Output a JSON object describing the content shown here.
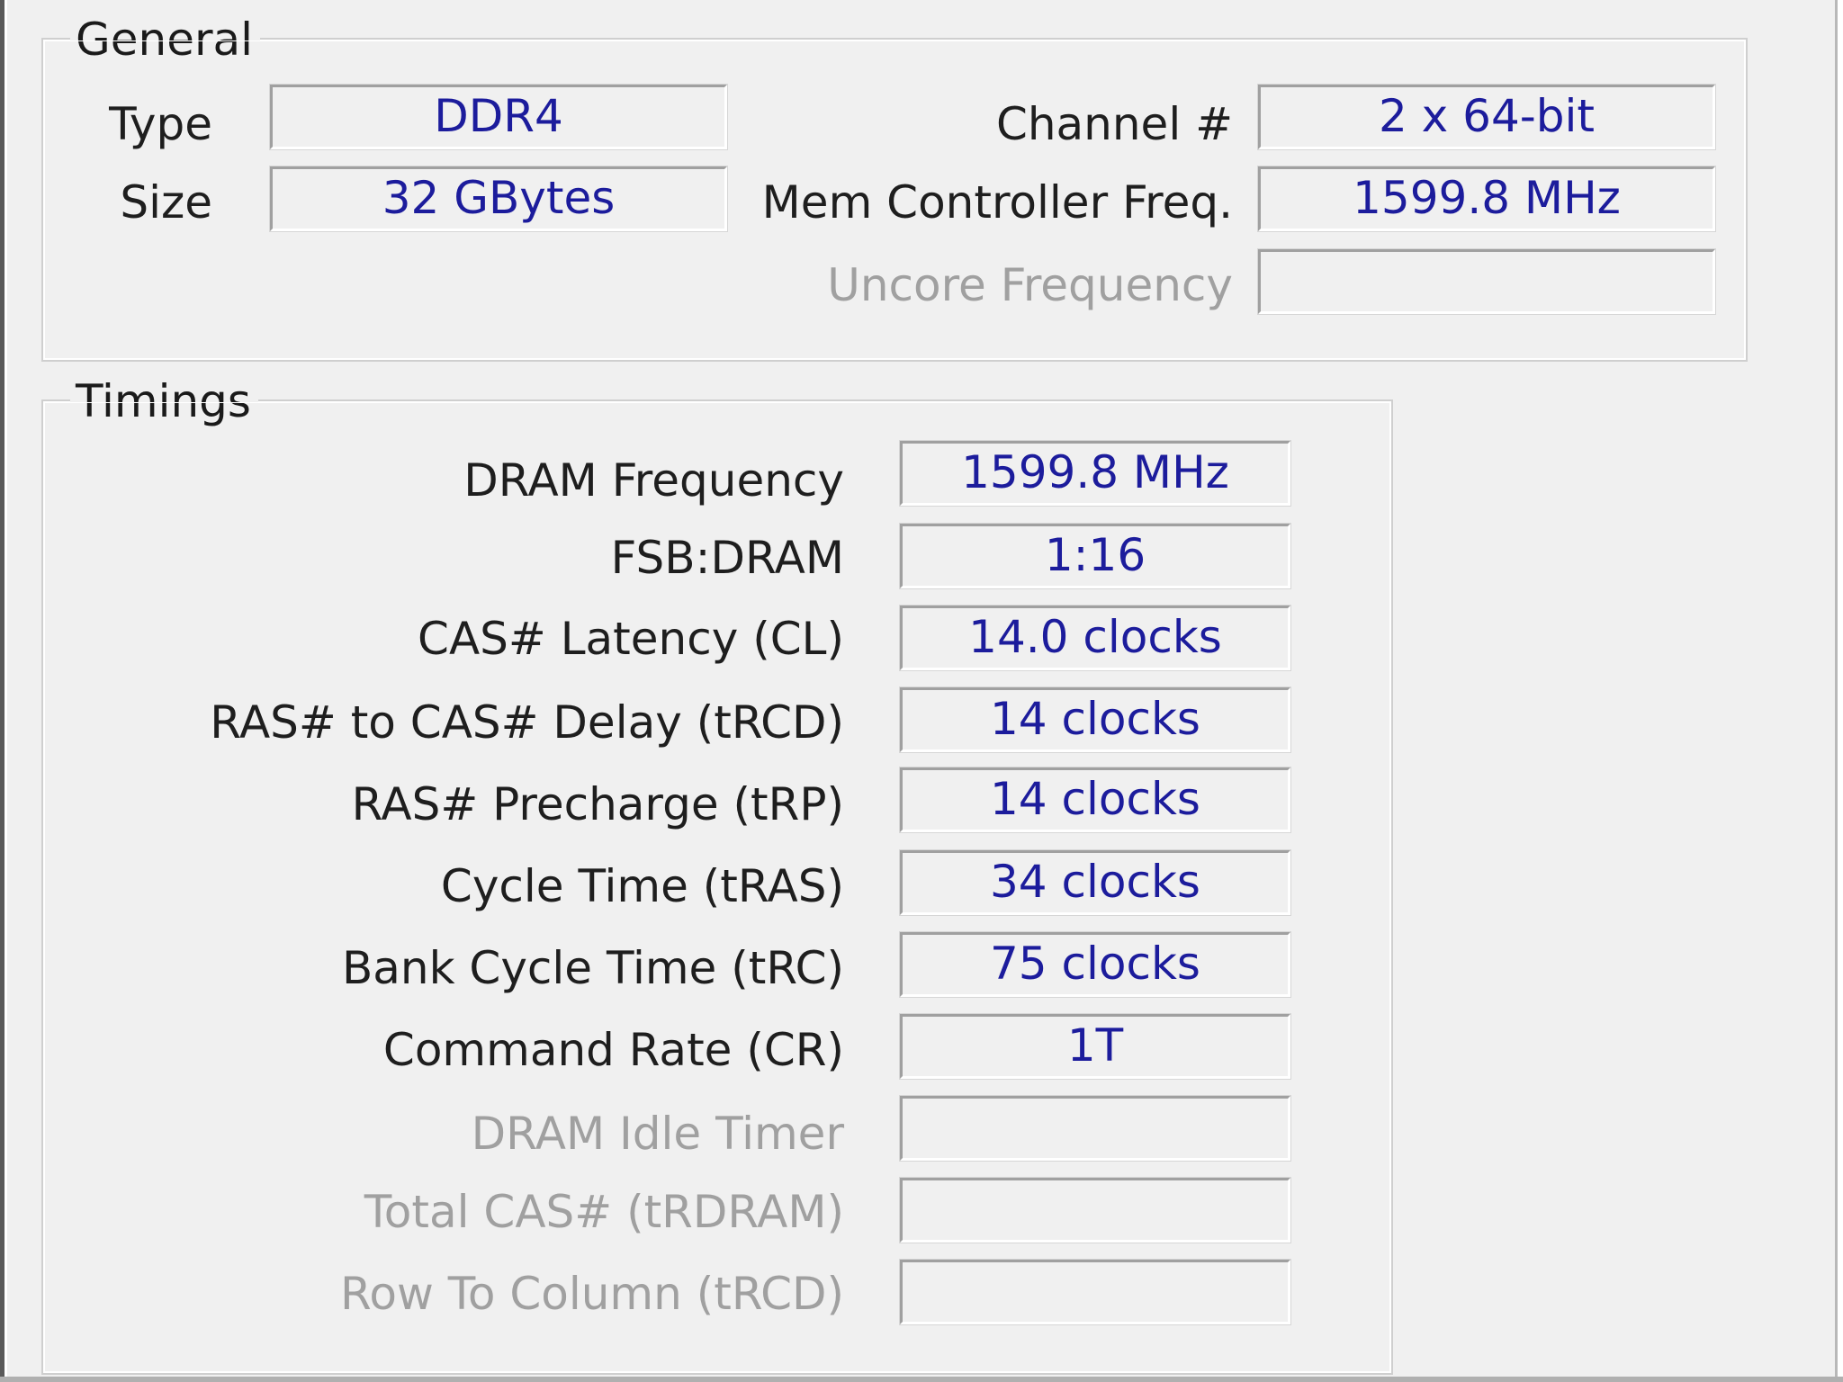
{
  "general": {
    "title": "General",
    "type_label": "Type",
    "type_value": "DDR4",
    "size_label": "Size",
    "size_value": "32 GBytes",
    "channel_label": "Channel #",
    "channel_value": "2 x 64-bit",
    "mem_ctrl_label": "Mem Controller Freq.",
    "mem_ctrl_value": "1599.8 MHz",
    "uncore_label": "Uncore Frequency",
    "uncore_value": ""
  },
  "timings": {
    "title": "Timings",
    "rows": [
      {
        "label": "DRAM Frequency",
        "value": "1599.8 MHz"
      },
      {
        "label": "FSB:DRAM",
        "value": "1:16"
      },
      {
        "label": "CAS# Latency (CL)",
        "value": "14.0 clocks"
      },
      {
        "label": "RAS# to CAS# Delay (tRCD)",
        "value": "14 clocks"
      },
      {
        "label": "RAS# Precharge (tRP)",
        "value": "14 clocks"
      },
      {
        "label": "Cycle Time (tRAS)",
        "value": "34 clocks"
      },
      {
        "label": "Bank Cycle Time (tRC)",
        "value": "75 clocks"
      },
      {
        "label": "Command Rate (CR)",
        "value": "1T"
      },
      {
        "label": "DRAM Idle Timer",
        "value": ""
      },
      {
        "label": "Total CAS# (tRDRAM)",
        "value": ""
      },
      {
        "label": "Row To Column (tRCD)",
        "value": ""
      }
    ]
  }
}
